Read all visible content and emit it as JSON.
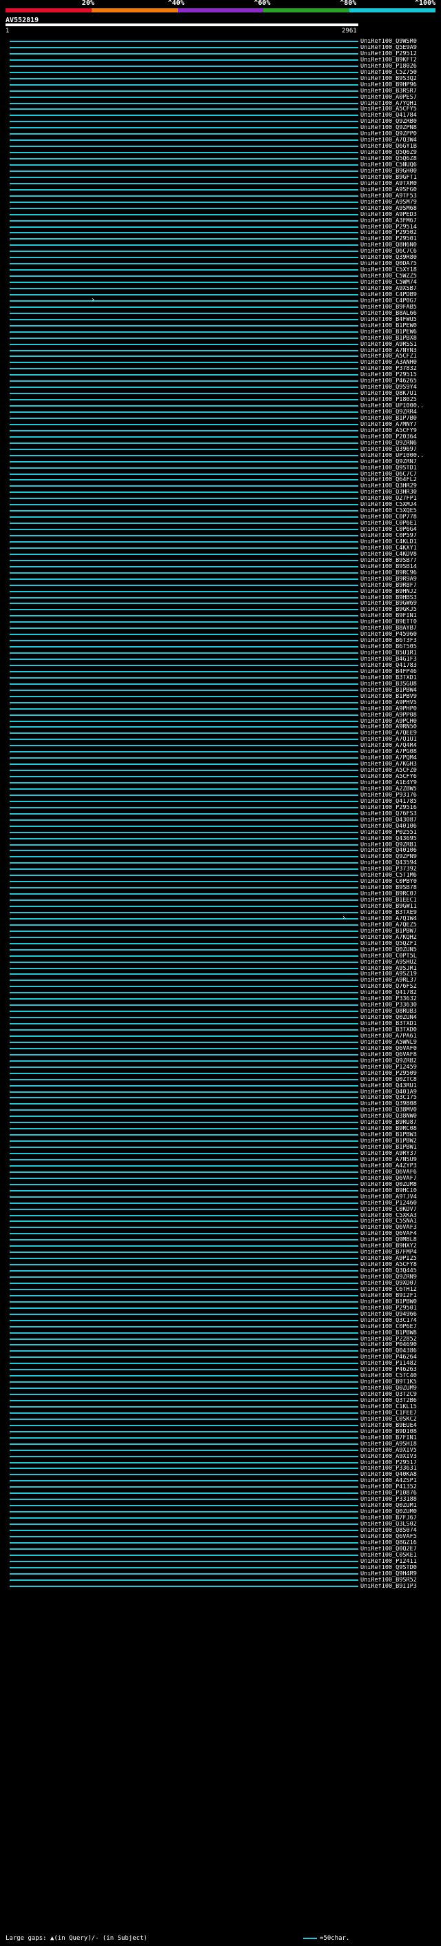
{
  "ruler": {
    "labels": [
      "20%",
      "^40%",
      "^60%",
      "^80%",
      "^100%"
    ],
    "colors": [
      "#e0102a",
      "#f07a12",
      "#8b2cc8",
      "#29a028",
      "#18c7d6"
    ]
  },
  "query": {
    "name": "AV552819",
    "start": "1",
    "end": "2961"
  },
  "hits": [
    "UniRef100_Q9WSR0",
    "UniRef100_Q5E9A9",
    "UniRef100_P29512",
    "UniRef100_B9KFT2",
    "UniRef100_P18026",
    "UniRef100_C5Z750",
    "UniRef100_B9S3Q2",
    "UniRef100_B9HP96",
    "UniRef100_B3RSR7",
    "UniRef100_A0PES7",
    "UniRef100_A7YQH1",
    "UniRef100_A5CFY5",
    "UniRef100_Q41784",
    "UniRef100_Q9ZRB0",
    "UniRef100_Q9ZPN8",
    "UniRef100_Q9ZPP0",
    "UniRef100_A7Q3W4",
    "UniRef100_Q6GY1B",
    "UniRef100_Q5Q6Z9",
    "UniRef100_Q5Q6Z8",
    "UniRef100_C5NUQ6",
    "UniRef100_B9GH00",
    "UniRef100_B9GFT1",
    "UniRef100_A9TXR0",
    "UniRef100_A9SFG0",
    "UniRef100_A9TF53",
    "UniRef100_A9SM79",
    "UniRef100_A9SM68",
    "UniRef100_A9PED3",
    "UniRef100_A3FM67",
    "UniRef100_P29514",
    "UniRef100_P29502",
    "UniRef100_P29501",
    "UniRef100_Q8H6N0",
    "UniRef100_Q6C7C6",
    "UniRef100_Q39R80",
    "UniRef100_Q0DA75",
    "UniRef100_C5XY18",
    "UniRef100_C5WZZ5",
    "UniRef100_C5WM74",
    "UniRef100_A9XSB7",
    "UniRef100_C4PDB9",
    "UniRef100_C4P0G7",
    "UniRef100_B9FAB5",
    "UniRef100_B8AL66",
    "UniRef100_B4FWU5",
    "UniRef100_B1PEW0",
    "UniRef100_B1PEW6",
    "UniRef100_B1PBX8",
    "UniRef100_A9RSS1",
    "UniRef100_A7NYN3",
    "UniRef100_A5CFZ1",
    "UniRef100_A3ANH0",
    "UniRef100_P37832",
    "UniRef100_P29515",
    "UniRef100_P46265",
    "UniRef100_Q9S9Y4",
    "UniRef100_Q8K7U1",
    "UniRef100_P18025",
    "UniRef100_UPI000..",
    "UniRef100_Q9ZRR4",
    "UniRef100_B1P7B0",
    "UniRef100_A7MNY7",
    "UniRef100_A5CFY9",
    "UniRef100_P20364",
    "UniRef100_Q9ZRN6",
    "UniRef100_Q39697",
    "UniRef100_UPI000..",
    "UniRef100_Q9ZRN7",
    "UniRef100_Q9STD1",
    "UniRef100_Q6C7C7",
    "UniRef100_Q64FL2",
    "UniRef100_Q3HR29",
    "UniRef100_Q3HR30",
    "UniRef100_O27FP1",
    "UniRef100_C5XMJ4",
    "UniRef100_C5XQE5",
    "UniRef100_C0P778",
    "UniRef100_C0P6E1",
    "UniRef100_C0P6G4",
    "UniRef100_C0P597",
    "UniRef100_C4KLD1",
    "UniRef100_C4KXY1",
    "UniRef100_C4KDV8",
    "UniRef100_B9SB77",
    "UniRef100_B9SB14",
    "UniRef100_B9RC96",
    "UniRef100_B9R9A9",
    "UniRef100_B9R8F7",
    "UniRef100_B9HNJ2",
    "UniRef100_B9HBS3",
    "UniRef100_B9GW69",
    "UniRef100_B9GKJ5",
    "UniRef100_B9FIN1",
    "UniRef100_B9ETT0",
    "UniRef100_B8AYB7",
    "UniRef100_P45960",
    "UniRef100_B6T3F3",
    "UniRef100_B6T505",
    "UniRef100_B5U1R1",
    "UniRef100_B4G1F3",
    "UniRef100_Q41783",
    "UniRef100_B4FP46",
    "UniRef100_B3TXD1",
    "UniRef100_B3SGU8",
    "UniRef100_B1PBW4",
    "UniRef100_B1PBV9",
    "UniRef100_A9PHV5",
    "UniRef100_A9PHP0",
    "UniRef100_A9PP08",
    "UniRef100_A9PCH0",
    "UniRef100_A9RN50",
    "UniRef100_A7QEE9",
    "UniRef100_A7Q1U1",
    "UniRef100_A7Q4R4",
    "UniRef100_A7PG08",
    "UniRef100_A7PQM4",
    "UniRef100_A7KGH3",
    "UniRef100_A5CFZ0",
    "UniRef100_A5CFY6",
    "UniRef100_A1E4Y9",
    "UniRef100_A2ZBW5",
    "UniRef100_P93176",
    "UniRef100_Q41785",
    "UniRef100_P29516",
    "UniRef100_Q76FS3",
    "UniRef100_Q43087",
    "UniRef100_Q40106",
    "UniRef100_P02551",
    "UniRef100_Q43695",
    "UniRef100_Q9ZRB1",
    "UniRef100_Q40106",
    "UniRef100_Q9ZPN9",
    "UniRef100_Q43594",
    "UniRef100_P37392",
    "UniRef100_C5T1M6",
    "UniRef100_C0PBY0",
    "UniRef100_B9SB78",
    "UniRef100_B9RC07",
    "UniRef100_B1EEC1",
    "UniRef100_B9GW11",
    "UniRef100_B3TXE9",
    "UniRef100_A7Q1W4",
    "UniRef100_A7QEZ5",
    "UniRef100_B1PBW7",
    "UniRef100_A7KQH2",
    "UniRef100_Q5QZF1",
    "UniRef100_Q0ZUN5",
    "UniRef100_C0PT5L",
    "UniRef100_A9SHU2",
    "UniRef100_A9SJR1",
    "UniRef100_A9SZ19",
    "UniRef100_A9RL37",
    "UniRef100_Q76FS2",
    "UniRef100_Q41782",
    "UniRef100_P33632",
    "UniRef100_P33630",
    "UniRef100_Q8RUB3",
    "UniRef100_Q0ZUN4",
    "UniRef100_B3TXD1",
    "UniRef100_B3TXD0",
    "UniRef100_A7PA61",
    "UniRef100_A5WNL9",
    "UniRef100_Q6VAF0",
    "UniRef100_Q6VAF8",
    "UniRef100_Q9ZRB2",
    "UniRef100_P12459",
    "UniRef100_P29509",
    "UniRef100_Q0ZTC8",
    "UniRef100_Q43RU1",
    "UniRef100_Q401A9",
    "UniRef100_Q3C175",
    "UniRef100_Q39808",
    "UniRef100_Q38MV0",
    "UniRef100_Q38NW0",
    "UniRef100_B9RU87",
    "UniRef100_B9RC08",
    "UniRef100_B1PBW3",
    "UniRef100_B1PBW2",
    "UniRef100_B1PBW1",
    "UniRef100_A9RY37",
    "UniRef100_A7NSU9",
    "UniRef100_A4ZYP3",
    "UniRef100_Q6VAF6",
    "UniRef100_Q6VAF7",
    "UniRef100_Q0ZUM8",
    "UniRef100_B9HCI0",
    "UniRef100_A9TJV4",
    "UniRef100_P12460",
    "UniRef100_C0KDV7",
    "UniRef100_C5XKA3",
    "UniRef100_C5SNA1",
    "UniRef100_Q6VAF3",
    "UniRef100_Q6VAF4",
    "UniRef100_Q9M8L8",
    "UniRef100_B9HXY2",
    "UniRef100_B7FMP4",
    "UniRef100_A9PI25",
    "UniRef100_A5CFY8",
    "UniRef100_Q3Q445",
    "UniRef100_Q9ZRN9",
    "UniRef100_Q9XD07",
    "UniRef100_C6TH12",
    "UniRef100_B9I2F1",
    "UniRef100_B1PBW0",
    "UniRef100_P29501",
    "UniRef100_Q94966",
    "UniRef100_Q3C174",
    "UniRef100_C0P6E7",
    "UniRef100_B1PBW8",
    "UniRef100_P22852",
    "UniRef100_P04690",
    "UniRef100_Q04386",
    "UniRef100_P46264",
    "UniRef100_P11482",
    "UniRef100_P46263",
    "UniRef100_C5TC40",
    "UniRef100_B9T1K5",
    "UniRef100_Q0ZUM9",
    "UniRef100_Q3T2C9",
    "UniRef100_Q3T2B6",
    "UniRef100_C1KL15",
    "UniRef100_C1FEE7",
    "UniRef100_C0SKC2",
    "UniRef100_B9EUE4",
    "UniRef100_B9D108",
    "UniRef100_B7FIN1",
    "UniRef100_A9SHI8",
    "UniRef100_A9XIV5",
    "UniRef100_A9XIV3",
    "UniRef100_P29517",
    "UniRef100_P33631",
    "UniRef100_Q40KA8",
    "UniRef100_A4ZSP1",
    "UniRef100_P41352",
    "UniRef100_P10876",
    "UniRef100_P33188",
    "UniRef100_Q0ZUM1",
    "UniRef100_Q0ZUM0",
    "UniRef100_B7FJ67",
    "UniRef100_Q3LS02",
    "UniRef100_Q8S074",
    "UniRef100_Q6VAF5",
    "UniRef100_Q8GZ16",
    "UniRef100_Q0Q2E7",
    "UniRef100_C0SKE1",
    "UniRef100_P12411",
    "UniRef100_Q9STD0",
    "UniRef100_Q9H4R9",
    "UniRef100_B9SR52",
    "UniRef100_B9I1P3"
  ],
  "arrows": [
    {
      "hit": 42,
      "symbol": "›"
    },
    {
      "hit": 142,
      "symbol": "›"
    }
  ],
  "legend": {
    "gaps": "Large gaps: ▲(in Query)/- (in Subject)",
    "scale": "=50char."
  }
}
